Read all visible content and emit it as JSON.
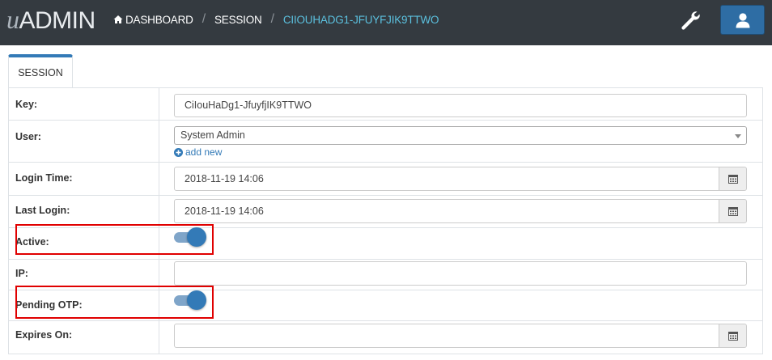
{
  "header": {
    "logo_prefix": "u",
    "logo_text": "ADMIN",
    "breadcrumbs": [
      {
        "label": "DASHBOARD",
        "icon": "home-icon"
      },
      {
        "label": "SESSION"
      },
      {
        "label": "CIIOUHADG1-JFUYFJIK9TTWO"
      }
    ],
    "tools_icon": "wrench-icon",
    "user_icon": "user-icon"
  },
  "tab": {
    "label": "SESSION"
  },
  "form": {
    "key": {
      "label": "Key:",
      "value": "CiIouHaDg1-JfuyfjIK9TTWO"
    },
    "user": {
      "label": "User:",
      "value": "System Admin",
      "add_new": "add new"
    },
    "login_time": {
      "label": "Login Time:",
      "value": "2018-11-19 14:06"
    },
    "last_login": {
      "label": "Last Login:",
      "value": "2018-11-19 14:06"
    },
    "active": {
      "label": "Active:",
      "checked": true
    },
    "ip": {
      "label": "IP:",
      "value": ""
    },
    "pending_otp": {
      "label": "Pending OTP:",
      "checked": true
    },
    "expires_on": {
      "label": "Expires On:",
      "value": ""
    }
  },
  "colors": {
    "topbar": "#343a40",
    "accent": "#337ab7",
    "breadcrumb_active": "#5bc0de",
    "highlight": "#e00000"
  }
}
